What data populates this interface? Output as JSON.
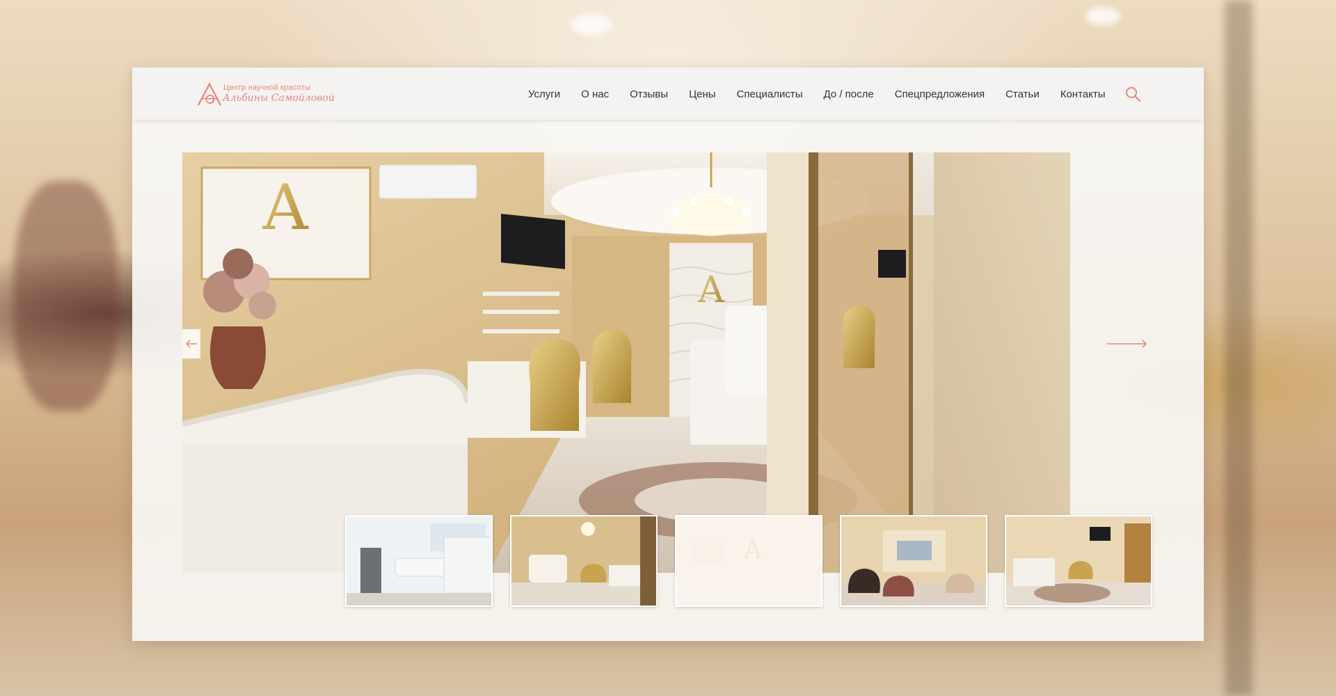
{
  "site": {
    "logo": {
      "line1": "Центр научной красоты",
      "line2": "Альбины Самойловой"
    },
    "nav": [
      {
        "label": "Услуги"
      },
      {
        "label": "О нас"
      },
      {
        "label": "Отзывы"
      },
      {
        "label": "Цены"
      },
      {
        "label": "Специалисты"
      },
      {
        "label": "До / после"
      },
      {
        "label": "Спецпредложения"
      },
      {
        "label": "Статьи"
      },
      {
        "label": "Контакты"
      }
    ],
    "search_icon": "search-icon",
    "accent_color": "#e8867a"
  },
  "slider": {
    "prev_icon": "arrow-left-icon",
    "next_icon": "arrow-right-icon",
    "thumbnails": [
      {
        "subject": "cosmetology-room",
        "active": false
      },
      {
        "subject": "manicure-hall",
        "active": false
      },
      {
        "subject": "reception-light",
        "active": true
      },
      {
        "subject": "hair-salon",
        "active": false
      },
      {
        "subject": "reception-hall",
        "active": false
      }
    ]
  }
}
